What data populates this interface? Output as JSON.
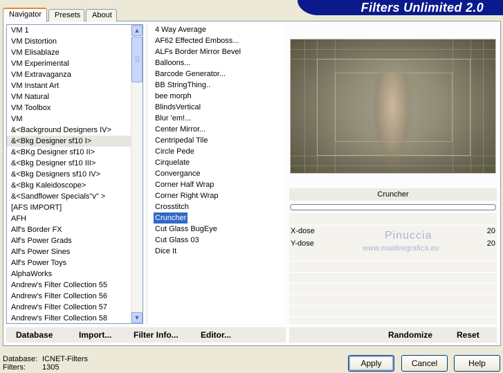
{
  "banner": {
    "title": "Filters Unlimited 2.0"
  },
  "tabs": [
    {
      "label": "Navigator",
      "active": true
    },
    {
      "label": "Presets",
      "active": false
    },
    {
      "label": "About",
      "active": false
    }
  ],
  "categories": [
    "VM 1",
    "VM Distortion",
    "VM Elisablaze",
    "VM Experimental",
    "VM Extravaganza",
    "VM Instant Art",
    "VM Natural",
    "VM Toolbox",
    "VM",
    "&<Background Designers IV>",
    "&<Bkg Designer sf10 I>",
    "&<BKg Designer sf10 II>",
    "&<Bkg Designer sf10 III>",
    "&<Bkg Designers sf10 IV>",
    "&<Bkg Kaleidoscope>",
    "&<Sandflower Specials\"v\" >",
    "[AFS IMPORT]",
    "AFH",
    "Alf's Border FX",
    "Alf's Power Grads",
    "Alf's Power Sines",
    "Alf's Power Toys",
    "AlphaWorks",
    "Andrew's Filter Collection 55",
    "Andrew's Filter Collection 56",
    "Andrew's Filter Collection 57",
    "Andrew's Filter Collection 58"
  ],
  "filters": [
    "4 Way Average",
    "AF62 Effected Emboss...",
    "ALFs Border Mirror Bevel",
    "Balloons...",
    "Barcode Generator...",
    "BB StringThing..",
    "bee morph",
    "BlindsVertical",
    "Blur 'em!...",
    "Center Mirror...",
    "Centripedal Tile",
    "Circle Pede",
    "Cirquelate",
    "Convergance",
    "Corner Half Wrap",
    "Corner Right Wrap",
    "Crosstitch",
    "Cruncher",
    "Cut Glass  BugEye",
    "Cut Glass 03",
    "Dice It"
  ],
  "selected_filter": "Cruncher",
  "params": [
    {
      "label": "X-dose",
      "value": "20"
    },
    {
      "label": "Y-dose",
      "value": "20"
    }
  ],
  "watermark": {
    "line1": "Pinuccia",
    "line2": "www.maidiregrafica.eu"
  },
  "toolbar": {
    "database": "Database",
    "import": "Import...",
    "filter_info": "Filter Info...",
    "editor": "Editor...",
    "randomize": "Randomize",
    "reset": "Reset"
  },
  "status": {
    "database_label": "Database:",
    "database_value": "ICNET-Filters",
    "filters_label": "Filters:",
    "filters_value": "1305"
  },
  "buttons": {
    "apply": "Apply",
    "cancel": "Cancel",
    "help": "Help"
  },
  "colors": {
    "banner": "#0a1a8c",
    "selection": "#316ac5",
    "tab_accent": "#e68b2c"
  }
}
